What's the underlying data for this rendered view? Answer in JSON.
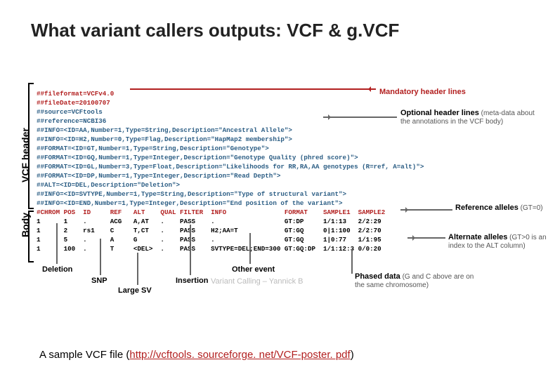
{
  "title": "What variant callers outputs: VCF & g.VCF",
  "sideLabels": {
    "header": "VCF header",
    "body": "Body"
  },
  "code": {
    "mandatory1": "##fileformat=VCFv4.0",
    "mandatory2": "##fileDate=20100707",
    "opt1": "##source=VCFtools",
    "opt2": "##reference=NCBI36",
    "info1": "##INFO=<ID=AA,Number=1,Type=String,Description=\"Ancestral Allele\">",
    "info2": "##INFO=<ID=H2,Number=0,Type=Flag,Description=\"HapMap2 membership\">",
    "fmt1": "##FORMAT=<ID=GT,Number=1,Type=String,Description=\"Genotype\">",
    "fmt2": "##FORMAT=<ID=GQ,Number=1,Type=Integer,Description=\"Genotype Quality (phred score)\">",
    "fmt3": "##FORMAT=<ID=GL,Number=3,Type=Float,Description=\"Likelihoods for RR,RA,AA genotypes (R=ref, A=alt)\">",
    "fmt4": "##FORMAT=<ID=DP,Number=1,Type=Integer,Description=\"Read Depth\">",
    "alt1": "##ALT=<ID=DEL,Description=\"Deletion\">",
    "info3": "##INFO=<ID=SVTYPE,Number=1,Type=String,Description=\"Type of structural variant\">",
    "info4": "##INFO=<ID=END,Number=1,Type=Integer,Description=\"End position of the variant\">",
    "cols": "#CHROM POS  ID     REF   ALT    QUAL FILTER  INFO               FORMAT    SAMPLE1  SAMPLE2",
    "row1": "1      1    .      ACG   A,AT   .    PASS    .                  GT:DP     1/1:13   2/2:29",
    "row2": "1      2    rs1    C     T,CT   .    PASS    H2;AA=T            GT:GQ     0|1:100  2/2:70",
    "row3": "1      5    .      A     G      .    PASS    .                  GT:GQ     1|0:77   1/1:95",
    "row4": "1      100  .      T     <DEL>  .    PASS    SVTYPE=DEL;END=300 GT:GQ:DP  1/1:12:3 0/0:20"
  },
  "annotations": {
    "mandatory": "Mandatory header lines",
    "optionalTitle": "Optional header lines",
    "optionalSub": " (meta-data about the annotations in the VCF body)",
    "refAlleles": "Reference alleles",
    "refAllelesSub": " (GT=0)",
    "altAlleles": "Alternate alleles",
    "altAllelesSub": " (GT>0 is an index to the ALT column)",
    "phased": "Phased data",
    "phasedSub": " (G and C above are on the same chromosome)",
    "deletion": "Deletion",
    "snp": "SNP",
    "largeSV": "Large SV",
    "insertion": "Insertion",
    "otherEvent": "Other event"
  },
  "caption": {
    "prefix": "A sample VCF file (",
    "url": "http://vcftools. sourceforge. net/VCF-poster. pdf",
    "suffix": ")"
  },
  "watermark": "Variant Calling – Yannick B"
}
